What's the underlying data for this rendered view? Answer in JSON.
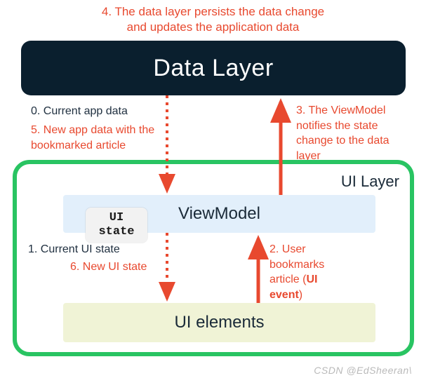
{
  "caption_top": "4. The data layer persists the data change\nand updates the application data",
  "data_layer": {
    "title": "Data Layer"
  },
  "labels": {
    "l0": "0. Current app data",
    "l5": "5. New app data with the bookmarked article",
    "l3": "3. The ViewModel notifies the state change to the data layer",
    "ui_layer": "UI Layer",
    "l1": "1. Current UI state",
    "l6": "6. New UI state",
    "l2_a": "2. User bookmarks article (",
    "l2_b": "UI event",
    "l2_c": ")"
  },
  "viewmodel": {
    "title": "ViewModel"
  },
  "ui_state": "UI\nstate",
  "ui_elements": {
    "title": "UI elements"
  },
  "watermark": "CSDN @EdSheeran\\",
  "colors": {
    "red": "#e8492f",
    "navy": "#203040",
    "green": "#29c462",
    "vm_bg": "#e2effb",
    "ue_bg": "#f0f3d6",
    "dl_bg": "#0a1f2e"
  }
}
